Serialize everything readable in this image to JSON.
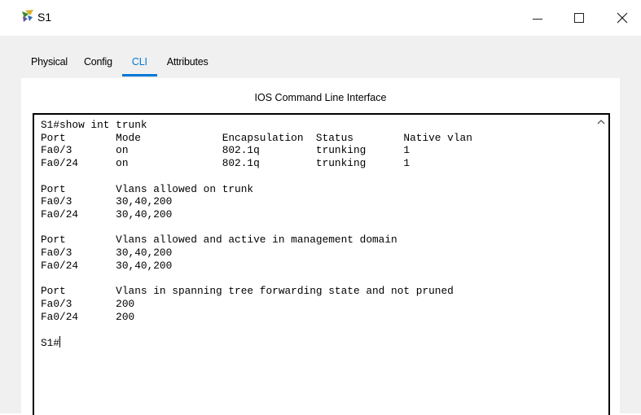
{
  "window": {
    "title": "S1",
    "app_icon": "packet-tracer-icon",
    "controls": [
      "minimize-icon",
      "maximize-icon",
      "close-icon"
    ],
    "close_glyph": "×"
  },
  "tabs": [
    {
      "label": "Physical",
      "active": false
    },
    {
      "label": "Config",
      "active": false
    },
    {
      "label": "CLI",
      "active": true
    },
    {
      "label": "Attributes",
      "active": false
    }
  ],
  "panel": {
    "title": "IOS Command Line Interface"
  },
  "terminal": {
    "lines": [
      "S1#show int trunk",
      "Port        Mode             Encapsulation  Status        Native vlan",
      "Fa0/3       on               802.1q         trunking      1",
      "Fa0/24      on               802.1q         trunking      1",
      "",
      "Port        Vlans allowed on trunk",
      "Fa0/3       30,40,200",
      "Fa0/24      30,40,200",
      "",
      "Port        Vlans allowed and active in management domain",
      "Fa0/3       30,40,200",
      "Fa0/24      30,40,200",
      "",
      "Port        Vlans in spanning tree forwarding state and not pruned",
      "Fa0/3       200",
      "Fa0/24      200",
      ""
    ],
    "prompt": "S1#"
  },
  "colors": {
    "accent": "#0078d7",
    "content_bg": "#f0f0f0",
    "terminal_border": "#000000"
  }
}
